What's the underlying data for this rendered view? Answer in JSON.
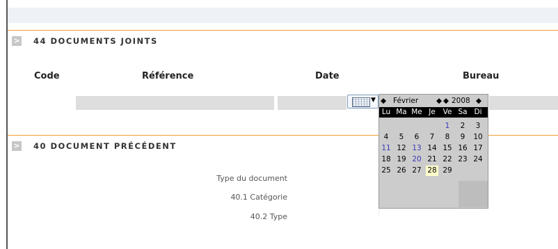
{
  "section_joints": {
    "chevron": ">",
    "title": "44 DOCUMENTS JOINTS"
  },
  "columns": [
    "Code",
    "Référence",
    "Date",
    "Bureau"
  ],
  "section_precedent": {
    "chevron": ">",
    "title": "40 DOCUMENT PRÉCÉDENT"
  },
  "fields": [
    "Type du document",
    "40.1 Catégorie",
    "40.2 Type"
  ],
  "calendar": {
    "prev_month_icon": "◆",
    "month": "Février",
    "next_month_icon": "◆",
    "prev_year_icon": "◆",
    "year": "2008",
    "next_year_icon": "◆",
    "weekdays": [
      "Lu",
      "Ma",
      "Me",
      "Je",
      "Ve",
      "Sa",
      "Di"
    ],
    "weeks": [
      [
        "",
        "",
        "",
        "",
        "1",
        "2",
        "3"
      ],
      [
        "4",
        "5",
        "6",
        "7",
        "8",
        "9",
        "10"
      ],
      [
        "11",
        "12",
        "13",
        "14",
        "15",
        "16",
        "17"
      ],
      [
        "18",
        "19",
        "20",
        "21",
        "22",
        "23",
        "24"
      ],
      [
        "25",
        "26",
        "27",
        "28",
        "29",
        "",
        ""
      ]
    ],
    "highlighted": [
      "1",
      "11",
      "13",
      "20"
    ],
    "selected": "28"
  },
  "colors": {
    "accent": "#f0a030",
    "highlight_day": "#3a3ab8",
    "selected_day_bg": "#ffffcc"
  }
}
